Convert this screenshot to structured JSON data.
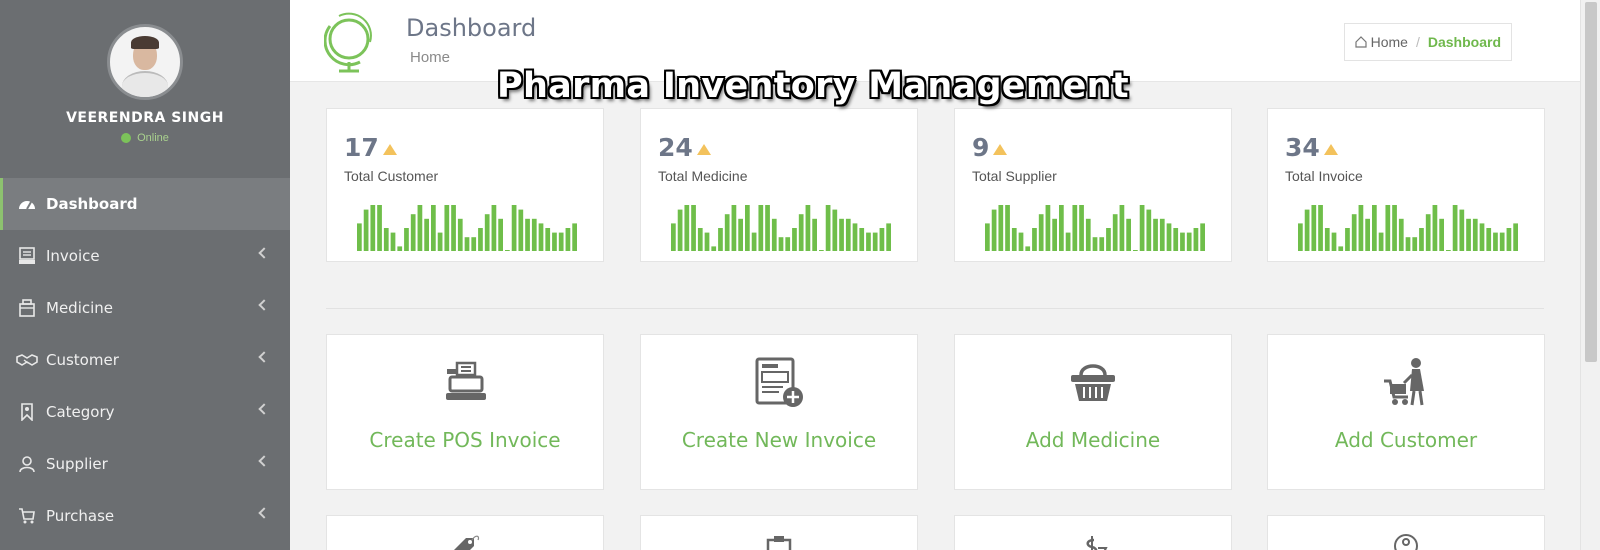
{
  "overlay_title": "Pharma Inventory Management",
  "user": {
    "name": "VEERENDRA SINGH",
    "status": "Online"
  },
  "sidebar": {
    "items": [
      {
        "label": "Dashboard",
        "icon": "dashboard-gauge-icon",
        "active": true
      },
      {
        "label": "Invoice",
        "icon": "invoice-icon",
        "active": false
      },
      {
        "label": "Medicine",
        "icon": "medicine-box-icon",
        "active": false
      },
      {
        "label": "Customer",
        "icon": "handshake-icon",
        "active": false
      },
      {
        "label": "Category",
        "icon": "bookmark-icon",
        "active": false
      },
      {
        "label": "Supplier",
        "icon": "user-icon",
        "active": false
      },
      {
        "label": "Purchase",
        "icon": "cart-icon",
        "active": false
      }
    ]
  },
  "header": {
    "title": "Dashboard",
    "subtitle": "Home",
    "breadcrumb": {
      "home": "Home",
      "separator": "/",
      "current": "Dashboard"
    }
  },
  "stats": [
    {
      "value": "17",
      "label": "Total Customer"
    },
    {
      "value": "24",
      "label": "Total Medicine"
    },
    {
      "value": "9",
      "label": "Total Supplier"
    },
    {
      "value": "34",
      "label": "Total Invoice"
    }
  ],
  "sparkline_values": [
    6,
    9,
    10,
    10,
    5,
    4,
    1,
    5,
    8,
    10,
    7,
    10,
    4,
    10,
    10,
    7,
    3,
    3,
    5,
    8,
    10,
    7,
    0,
    10,
    9,
    7,
    7,
    6,
    5,
    4,
    4,
    5,
    6
  ],
  "actions": [
    {
      "label": "Create POS Invoice",
      "icon": "pos-register-icon"
    },
    {
      "label": "Create New Invoice",
      "icon": "invoice-add-icon"
    },
    {
      "label": "Add Medicine",
      "icon": "basket-icon"
    },
    {
      "label": "Add Customer",
      "icon": "shopper-cart-icon"
    }
  ],
  "partial_actions": [
    {
      "icon": "tag-icon"
    },
    {
      "icon": "clipboard-icon"
    },
    {
      "icon": "dollar-icon"
    },
    {
      "icon": "location-icon"
    }
  ],
  "colors": {
    "sidebar_bg": "#6b6e71",
    "accent_green": "#72b85a",
    "bar_green": "#6fbe4a",
    "trend_up": "#f3c25c",
    "title_slate": "#6d7688"
  }
}
